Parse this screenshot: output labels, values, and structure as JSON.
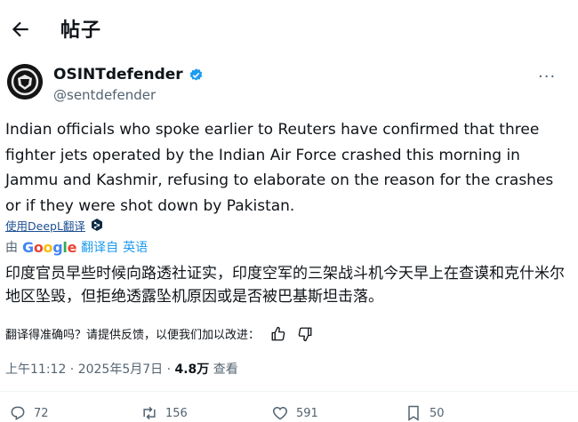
{
  "header": {
    "title": "帖子"
  },
  "author": {
    "name": "OSINTdefender",
    "handle": "@sentdefender"
  },
  "tweet": {
    "text": "Indian officials who spoke earlier to Reuters have confirmed that three fighter jets operated by the Indian Air Force crashed this morning in Jammu and Kashmir, refusing to elaborate on the reason for the crashes or if they were shot down by Pakistan."
  },
  "translation": {
    "deepl_label": "使用DeepL翻译",
    "by_label": "由",
    "google": "Google",
    "translated_from": "翻译自",
    "source_lang": "英语",
    "text": "印度官员早些时候向路透社证实，印度空军的三架战斗机今天早上在查谟和克什米尔地区坠毁，但拒绝透露坠机原因或是否被巴基斯坦击落。",
    "feedback": "翻译得准确吗？请提供反馈，以便我们加以改进："
  },
  "meta": {
    "time": "上午11:12 · 2025年5月7日 · ",
    "views": "4.8万",
    "views_label": " 查看"
  },
  "actions": {
    "replies": "72",
    "reposts": "156",
    "likes": "591",
    "bookmarks": "50"
  },
  "colors": {
    "accent": "#1d9bf0",
    "text": "#0f1419",
    "muted": "#536471"
  }
}
